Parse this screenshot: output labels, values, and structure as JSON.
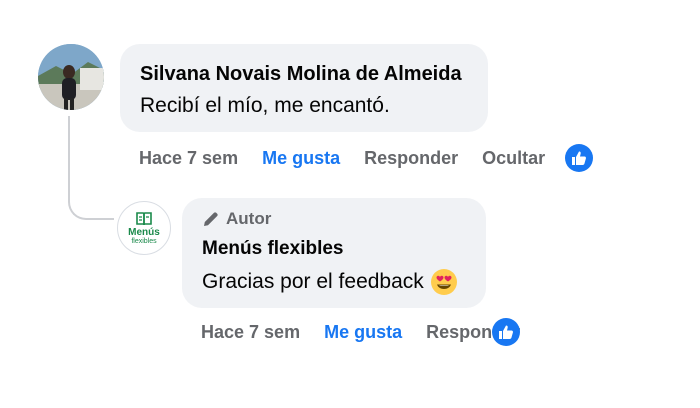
{
  "comment": {
    "author": "Silvana Novais Molina de Almeida",
    "text": "Recibí el mío, me encantó.",
    "actions": {
      "time": "Hace 7 sem",
      "like": "Me gusta",
      "reply": "Responder",
      "hide": "Ocultar"
    }
  },
  "reply": {
    "badge": "Autor",
    "author": "Menús flexibles",
    "text": "Gracias por el feedback",
    "emoji": "heart-eyes-emoji",
    "page_logo": {
      "line1": "Menús",
      "line2": "flexibles"
    },
    "actions": {
      "time": "Hace 7 sem",
      "like": "Me gusta",
      "reply": "Responder"
    }
  },
  "colors": {
    "like_blue": "#1877f2",
    "bubble_bg": "#f0f2f5",
    "muted": "#65676b",
    "brand_green": "#1b8a4b"
  }
}
